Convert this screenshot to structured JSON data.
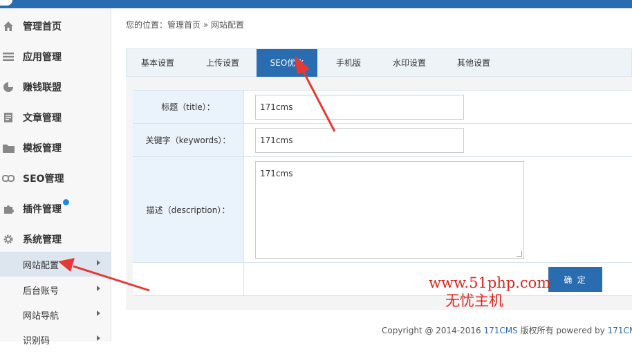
{
  "sidebar": {
    "items": [
      {
        "label": "管理首页",
        "icon": "home-icon"
      },
      {
        "label": "应用管理",
        "icon": "menu-icon"
      },
      {
        "label": "赚钱联盟",
        "icon": "pie-chart-icon"
      },
      {
        "label": "文章管理",
        "icon": "document-icon"
      },
      {
        "label": "模板管理",
        "icon": "folder-icon"
      },
      {
        "label": "SEO管理",
        "icon": "link-icon"
      },
      {
        "label": "插件管理",
        "icon": "puzzle-icon"
      },
      {
        "label": "系统管理",
        "icon": "gear-icon"
      }
    ],
    "sub_items": [
      {
        "label": "网站配置",
        "active": true
      },
      {
        "label": "后台账号",
        "active": false
      },
      {
        "label": "网站导航",
        "active": false
      },
      {
        "label": "识别码",
        "active": false
      }
    ]
  },
  "breadcrumb": {
    "prefix": "您的位置：",
    "home": "管理首页",
    "separator": " » ",
    "current": "网站配置"
  },
  "tabs": [
    {
      "label": "基本设置",
      "active": false
    },
    {
      "label": "上传设置",
      "active": false
    },
    {
      "label": "SEO优化",
      "active": true
    },
    {
      "label": "手机版",
      "active": false
    },
    {
      "label": "水印设置",
      "active": false
    },
    {
      "label": "其他设置",
      "active": false
    }
  ],
  "form": {
    "title_label": "标题（title）：",
    "title_value": "171cms",
    "keywords_label": "关键字（keywords）：",
    "keywords_value": "171cms",
    "description_label": "描述（description）：",
    "description_value": "171cms",
    "submit_label": "确 定"
  },
  "watermark": {
    "line1": "www.51php.com",
    "line2": "无忧主机"
  },
  "footer": {
    "prefix": "Copyright @ 2014-2016 ",
    "brand": "171CMS",
    "middle": " 版权所有 powered by ",
    "brand2": "171CM"
  },
  "colors": {
    "accent": "#2a6cb0",
    "annotation_arrow": "#e53935",
    "watermark": "#d9251c",
    "notification_badge": "#1e88e5"
  }
}
